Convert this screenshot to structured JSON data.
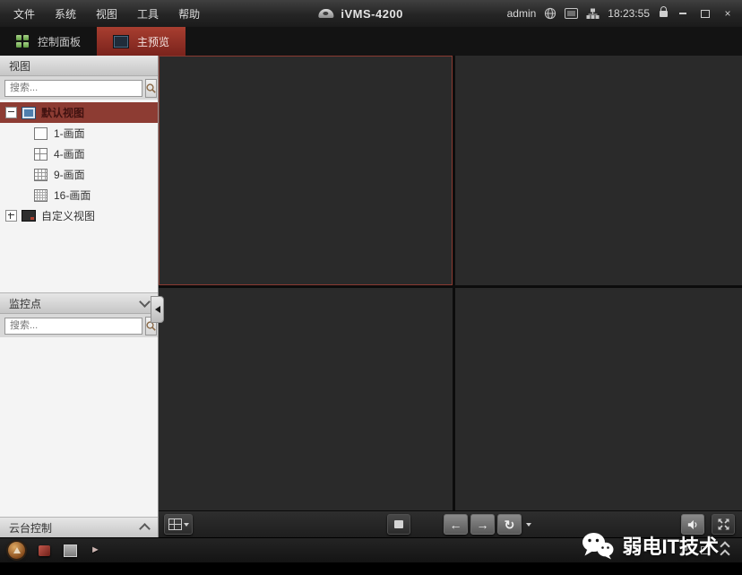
{
  "titlebar": {
    "menu": [
      {
        "label": "文件"
      },
      {
        "label": "系统"
      },
      {
        "label": "视图"
      },
      {
        "label": "工具"
      },
      {
        "label": "帮助"
      }
    ],
    "app_title": "iVMS-4200",
    "user": "admin",
    "time": "18:23:55",
    "window": {
      "close": "×"
    }
  },
  "tabs": {
    "control_panel": "控制面板",
    "main_preview": "主预览"
  },
  "sidebar": {
    "view_panel": {
      "title": "视图",
      "search_placeholder": "搜索...",
      "search_value": ""
    },
    "tree": {
      "default_view": "默认视图",
      "layouts": [
        {
          "label": "1-画面"
        },
        {
          "label": "4-画面"
        },
        {
          "label": "9-画面"
        },
        {
          "label": "16-画面"
        }
      ],
      "custom_view": "自定义视图"
    },
    "camera_panel": {
      "title": "监控点",
      "search_placeholder": "搜索...",
      "search_value": ""
    },
    "ptz_panel": {
      "title": "云台控制"
    }
  },
  "main": {
    "video_panes": 4,
    "selected_pane": 1,
    "toolbar": {
      "prev_glyph": "←",
      "next_glyph": "→",
      "refresh_glyph": "↻"
    }
  },
  "statusbar": {
    "arrow_glyph": "►"
  },
  "watermark": {
    "text": "弱电IT技术"
  },
  "colors": {
    "active_tab_red": "#96352a",
    "tree_selection_red": "#8d3c33",
    "pane_selection_border": "#8a3a31",
    "dashboard_green": "#79b35a"
  },
  "icons": {
    "search": "magnifier",
    "camera": "dome-camera",
    "globe": "globe",
    "screen": "monitor",
    "network": "hub",
    "lock": "padlock",
    "chevron_down": "chevron-down",
    "chevron_up": "chevron-up",
    "screen_division": "grid-2x2",
    "stop": "square",
    "volume": "speaker",
    "fullscreen": "expand-arrows",
    "alarm": "warning-circle",
    "log": "red-badge",
    "picture": "image",
    "arrow": "play-right",
    "pin": "pin",
    "restore": "square-outline",
    "collapse": "double-chevron-up",
    "wechat": "wechat-logo"
  }
}
